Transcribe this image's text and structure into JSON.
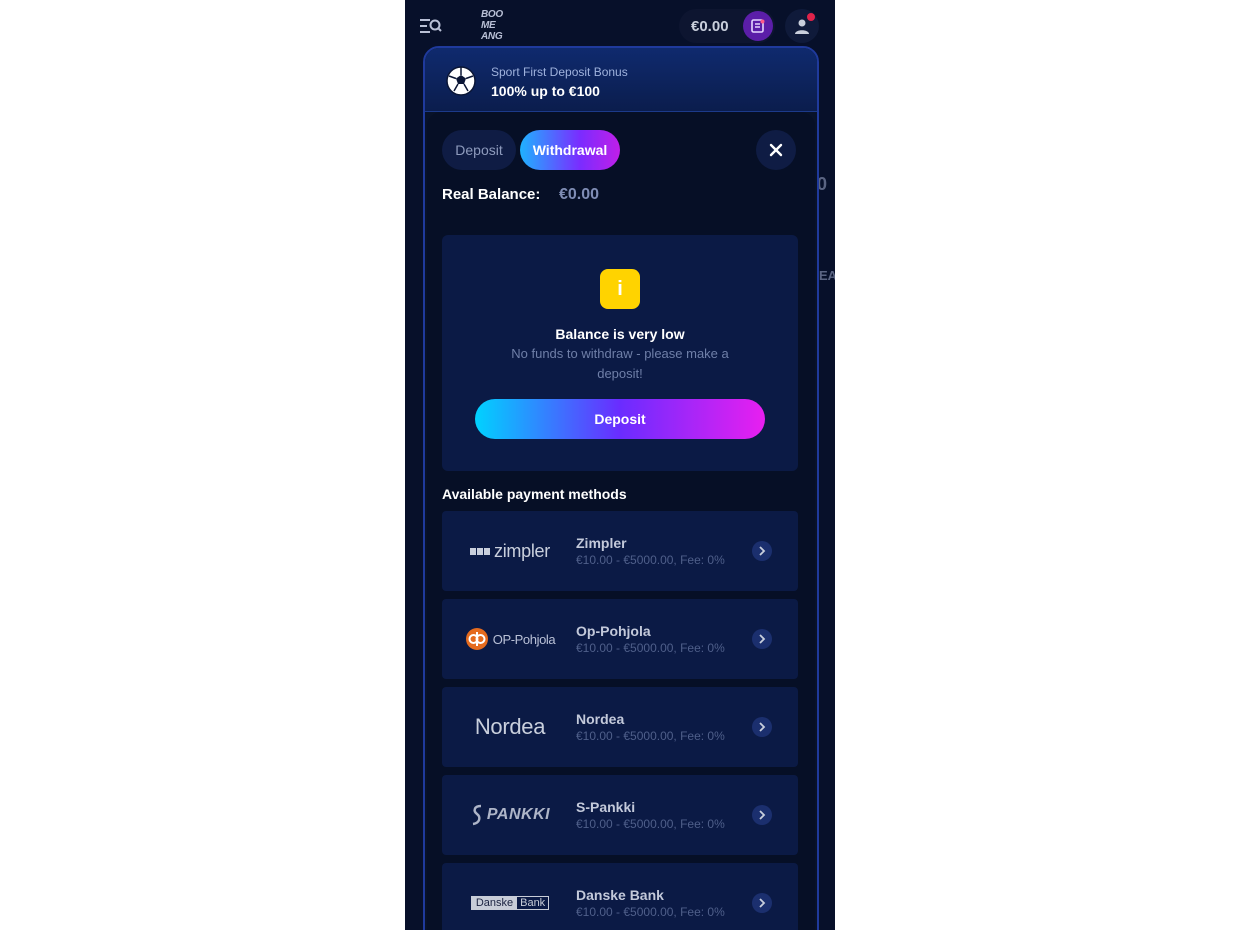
{
  "header": {
    "logo_lines": [
      "BOO",
      "ME",
      "ANG"
    ],
    "balance": "€0.00"
  },
  "bonus": {
    "subtitle": "Sport First Deposit Bonus",
    "title": "100% up to €100"
  },
  "tabs": {
    "deposit": "Deposit",
    "withdrawal": "Withdrawal"
  },
  "real_balance": {
    "label": "Real Balance:",
    "value": "€0.00"
  },
  "notice": {
    "icon_glyph": "i",
    "title": "Balance is very low",
    "description": "No funds to withdraw - please make a deposit!",
    "button_label": "Deposit"
  },
  "methods": {
    "heading": "Available payment methods",
    "items": [
      {
        "name": "Zimpler",
        "range": "€10.00 - €5000.00, Fee: 0%",
        "logo_text": "zimpler",
        "logo": "zimpler-logo"
      },
      {
        "name": "Op-Pohjola",
        "range": "€10.00 - €5000.00, Fee: 0%",
        "logo_text": "OP-Pohjola",
        "logo": "op-pohjola-logo"
      },
      {
        "name": "Nordea",
        "range": "€10.00 - €5000.00, Fee: 0%",
        "logo_text": "Nordea",
        "logo": "nordea-logo"
      },
      {
        "name": "S-Pankki",
        "range": "€10.00 - €5000.00, Fee: 0%",
        "logo_text": "PANKKI",
        "logo": "s-pankki-logo"
      },
      {
        "name": "Danske Bank",
        "range": "€10.00 - €5000.00, Fee: 0%",
        "logo_text_left": "Danske",
        "logo_text_right": "Bank",
        "logo": "danske-bank-logo"
      }
    ]
  },
  "colors": {
    "background": "#07102a",
    "accent_gradient_start": "#00d2ff",
    "accent_gradient_end": "#e81ff0",
    "warning": "#ffd300"
  }
}
